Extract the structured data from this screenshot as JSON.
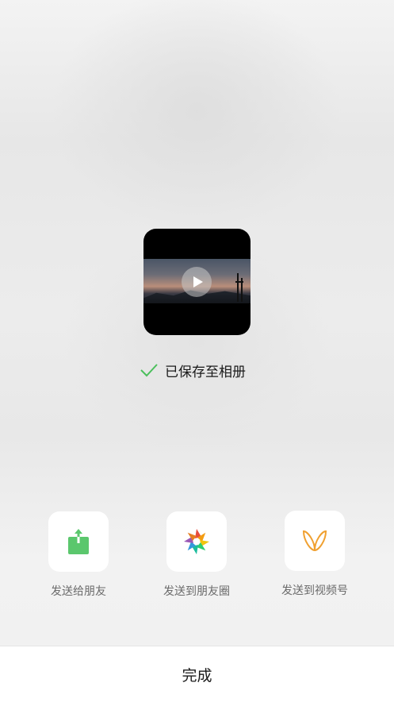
{
  "status": {
    "saved_text": "已保存至相册"
  },
  "video": {
    "play_icon": "play-icon"
  },
  "actions": [
    {
      "label": "发送给朋友",
      "icon": "share-icon",
      "color": "#5bc76d"
    },
    {
      "label": "发送到朋友圈",
      "icon": "moments-aperture-icon"
    },
    {
      "label": "发送到视频号",
      "icon": "channels-icon",
      "color": "#f0a030"
    }
  ],
  "footer": {
    "done_label": "完成"
  },
  "colors": {
    "check": "#4bbf5c",
    "accent_orange": "#f0a030"
  }
}
